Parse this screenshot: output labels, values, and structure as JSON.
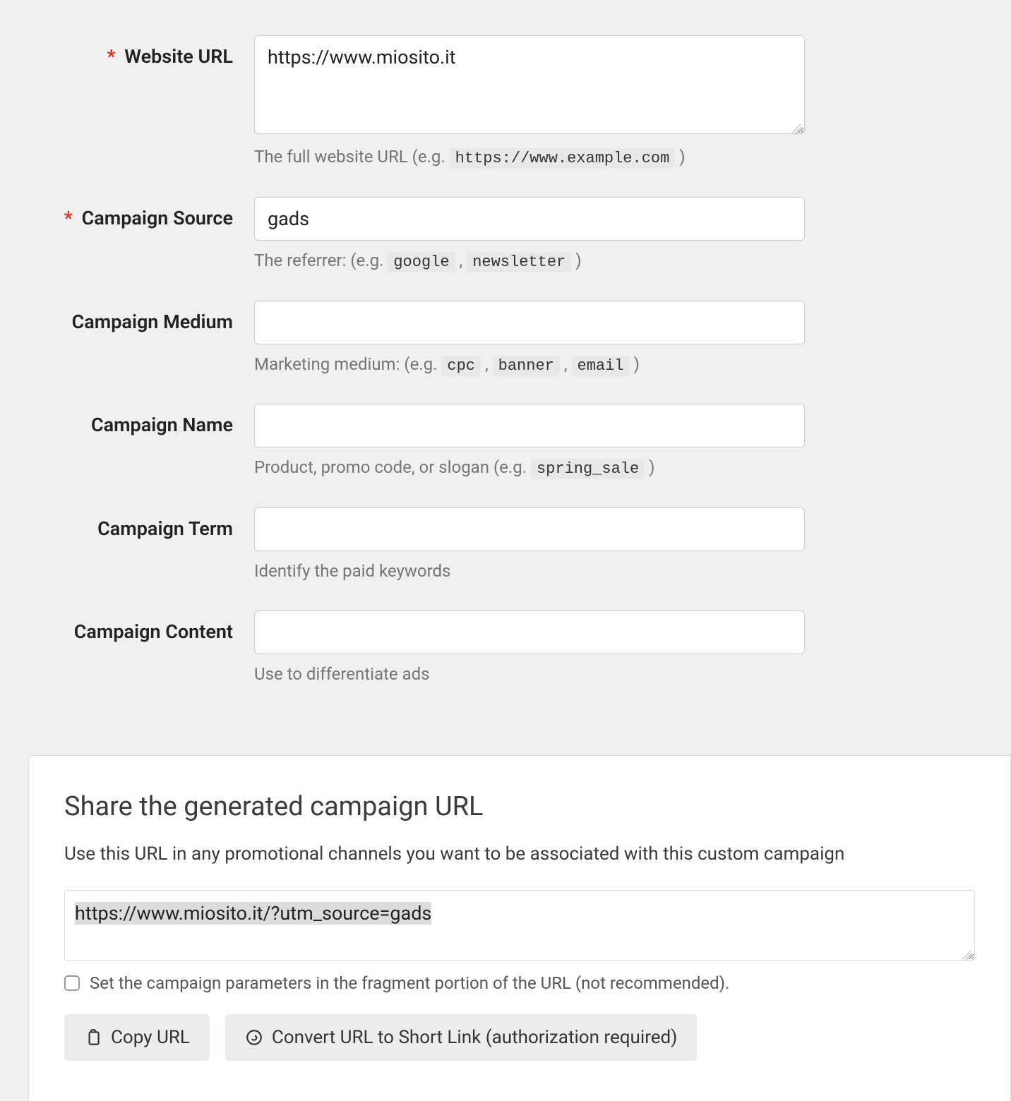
{
  "fields": {
    "website_url": {
      "label": "Website URL",
      "required": true,
      "value": "https://www.miosito.it",
      "hint_prefix": "The full website URL (e.g. ",
      "hint_codes": [
        "https://www.example.com"
      ],
      "hint_suffix": " )"
    },
    "campaign_source": {
      "label": "Campaign Source",
      "required": true,
      "value": "gads",
      "hint_prefix": "The referrer: (e.g. ",
      "hint_codes": [
        "google",
        "newsletter"
      ],
      "hint_suffix": " )"
    },
    "campaign_medium": {
      "label": "Campaign Medium",
      "required": false,
      "value": "",
      "hint_prefix": "Marketing medium: (e.g. ",
      "hint_codes": [
        "cpc",
        "banner",
        "email"
      ],
      "hint_suffix": " )"
    },
    "campaign_name": {
      "label": "Campaign Name",
      "required": false,
      "value": "",
      "hint_prefix": "Product, promo code, or slogan (e.g. ",
      "hint_codes": [
        "spring_sale"
      ],
      "hint_suffix": " )"
    },
    "campaign_term": {
      "label": "Campaign Term",
      "required": false,
      "value": "",
      "hint_plain": "Identify the paid keywords"
    },
    "campaign_content": {
      "label": "Campaign Content",
      "required": false,
      "value": "",
      "hint_plain": "Use to differentiate ads"
    }
  },
  "share": {
    "title": "Share the generated campaign URL",
    "description": "Use this URL in any promotional channels you want to be associated with this custom campaign",
    "generated_url": "https://www.miosito.it/?utm_source=gads",
    "fragment_checkbox_label": "Set the campaign parameters in the fragment portion of the URL (not recommended).",
    "fragment_checked": false,
    "copy_button": "Copy URL",
    "shortlink_button": "Convert URL to Short Link (authorization required)"
  },
  "required_marker": "*"
}
